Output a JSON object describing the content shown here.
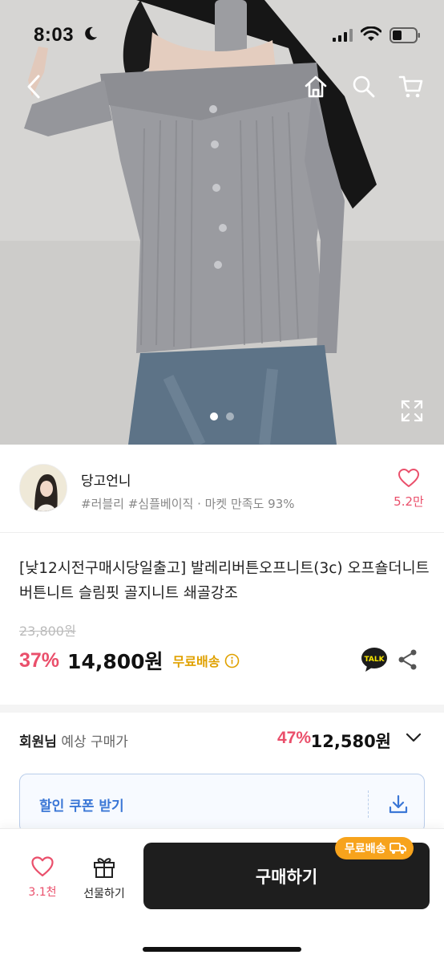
{
  "status_bar": {
    "time": "8:03"
  },
  "hero": {
    "page_count": 2,
    "current_page": 1
  },
  "seller": {
    "name": "당고언니",
    "tags": "#러블리 #심플베이직 · 마켓 만족도 93%",
    "likes": "5.2만"
  },
  "product": {
    "title": "[낮12시전구매시당일출고] 발레리버튼오프니트(3c) 오프숄더니트 버튼니트 슬림핏 골지니트 쇄골강조",
    "original_price": "23,800원",
    "discount": "37%",
    "price": "14,800원",
    "free_shipping": "무료배송"
  },
  "member": {
    "label": "회원님",
    "sub_label": "예상 구매가",
    "discount": "47%",
    "price": "12,580원"
  },
  "coupon": {
    "label": "할인 쿠폰 받기"
  },
  "bottom_bar": {
    "like_count": "3.1천",
    "gift_label": "선물하기",
    "buy_label": "구매하기",
    "ship_badge": "무료배송"
  },
  "colors": {
    "accent_pink": "#ea4f6b",
    "free_ship_yellow": "#e0a100",
    "coupon_blue": "#3b77d6",
    "badge_orange": "#f7a31c",
    "buy_button": "#1e1e1e"
  }
}
